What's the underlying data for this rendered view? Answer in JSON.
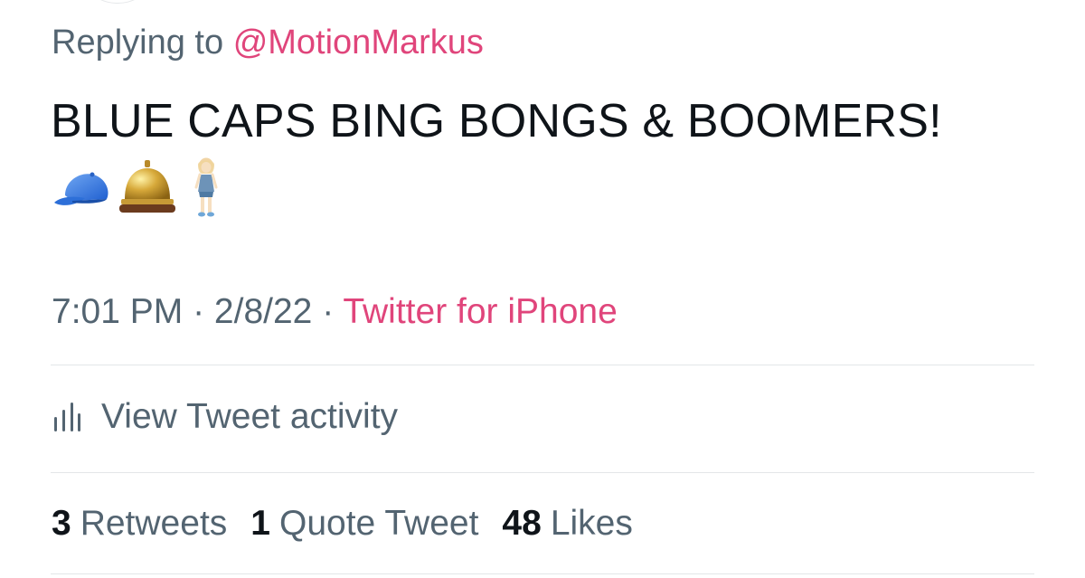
{
  "reply": {
    "prefix": "Replying to",
    "handle": "@MotionMarkus"
  },
  "tweet": {
    "text": "BLUE CAPS BING BONGS & BOOMERS!",
    "emojis": [
      "blue-cap-icon",
      "bellhop-bell-icon",
      "standing-woman-icon"
    ]
  },
  "meta": {
    "time": "7:01 PM",
    "separator1": " · ",
    "date": "2/8/22",
    "separator2": " · ",
    "source": "Twitter for iPhone"
  },
  "activity": {
    "label": "View Tweet activity",
    "icon": "analytics-bars-icon"
  },
  "stats": {
    "retweets_count": "3",
    "retweets_label": "Retweets",
    "quotes_count": "1",
    "quotes_label": "Quote Tweet",
    "likes_count": "48",
    "likes_label": "Likes"
  },
  "colors": {
    "accent": "#e0457b",
    "secondary_text": "#536471",
    "primary_text": "#0f1419",
    "divider": "#e3e6e8"
  }
}
